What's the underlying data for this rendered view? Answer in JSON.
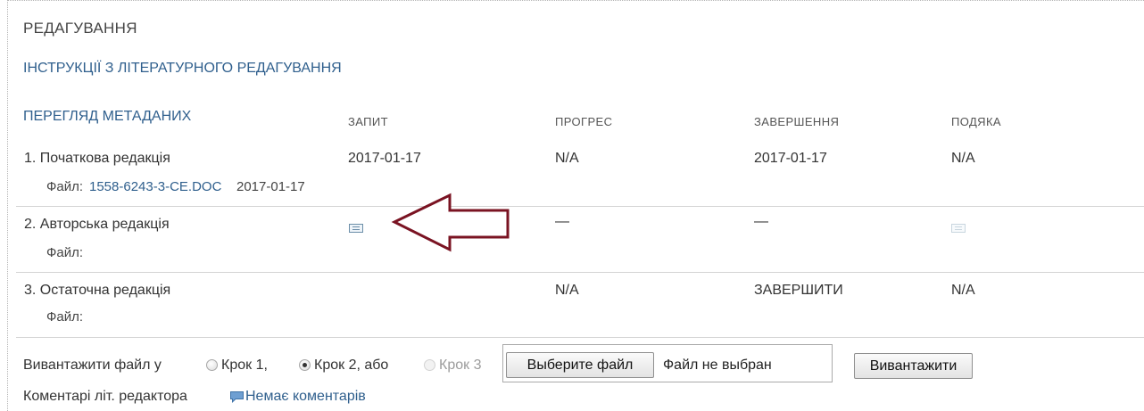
{
  "section": {
    "title": "РЕДАГУВАННЯ",
    "instructions_link": "ІНСТРУКЦІЇ З ЛІТЕРАТУРНОГО РЕДАГУВАННЯ",
    "metadata_link": "ПЕРЕГЛЯД МЕТАДАНИХ"
  },
  "table": {
    "columns": {
      "request": "ЗАПИТ",
      "progress": "ПРОГРЕС",
      "completion": "ЗАВЕРШЕННЯ",
      "thanks": "ПОДЯКА"
    },
    "rows": [
      {
        "label": "1. Початкова редакція",
        "file_label": "Файл:",
        "file_name": "1558-6243-3-CE.DOC",
        "file_date": "2017-01-17",
        "request": "2017-01-17",
        "progress": "N/A",
        "completion": "2017-01-17",
        "thanks": "N/A"
      },
      {
        "label": "2. Авторська редакція",
        "file_label": "Файл:",
        "request_icon": "envelope-icon",
        "progress": "—",
        "completion": "—",
        "thanks_icon": "envelope-icon-disabled"
      },
      {
        "label": "3. Остаточна редакція",
        "file_label": "Файл:",
        "progress": "N/A",
        "completion": "ЗАВЕРШИТИ",
        "thanks": "N/A"
      }
    ]
  },
  "upload": {
    "prefix": "Вивантажити файл у",
    "options": [
      {
        "label": "Крок 1,",
        "checked": false,
        "disabled": false
      },
      {
        "label": "Крок 2, або",
        "checked": true,
        "disabled": false
      },
      {
        "label": "Крок 3",
        "checked": false,
        "disabled": true
      }
    ],
    "choose_button": "Выберите файл",
    "no_file_text": "Файл не выбран",
    "upload_button": "Вивантажити"
  },
  "comments": {
    "label": "Коментарі літ. редактора",
    "link": "Немає коментарів",
    "icon": "chat-bubble-icon"
  },
  "annotation": {
    "arrow_color": "#7a1322",
    "arrow_icon": "left-arrow-icon"
  },
  "colors": {
    "link": "#2f5f8d",
    "text": "#333333",
    "divider": "#d4d4d4"
  }
}
